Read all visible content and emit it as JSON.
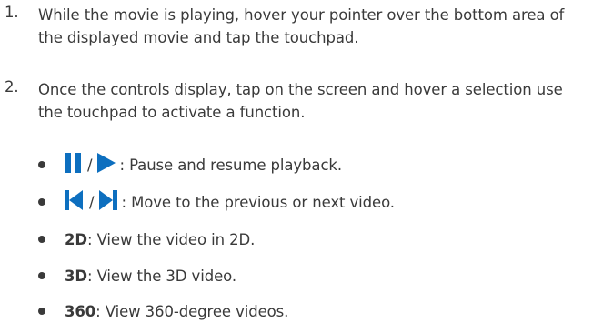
{
  "steps": [
    {
      "number": "1.",
      "text": "While the movie is playing, hover your pointer over the bottom area of the displayed movie and tap the touchpad."
    },
    {
      "number": "2.",
      "text": "Once the controls display, tap on the screen and hover a selection use the touchpad to activate a function."
    }
  ],
  "controls": [
    {
      "icons": [
        "pause-icon",
        "play-icon"
      ],
      "separator": "/",
      "description": ": Pause and resume playback."
    },
    {
      "icons": [
        "previous-icon",
        "next-icon"
      ],
      "separator": "/",
      "description": ": Move to the previous or next video."
    },
    {
      "term": "2D",
      "description": ": View the video in 2D."
    },
    {
      "term": "3D",
      "description": ": View the 3D video."
    },
    {
      "term": "360",
      "description": ": View 360-degree videos."
    }
  ],
  "colors": {
    "text": "#3a3a3a",
    "icon": "#0d6fbf"
  }
}
